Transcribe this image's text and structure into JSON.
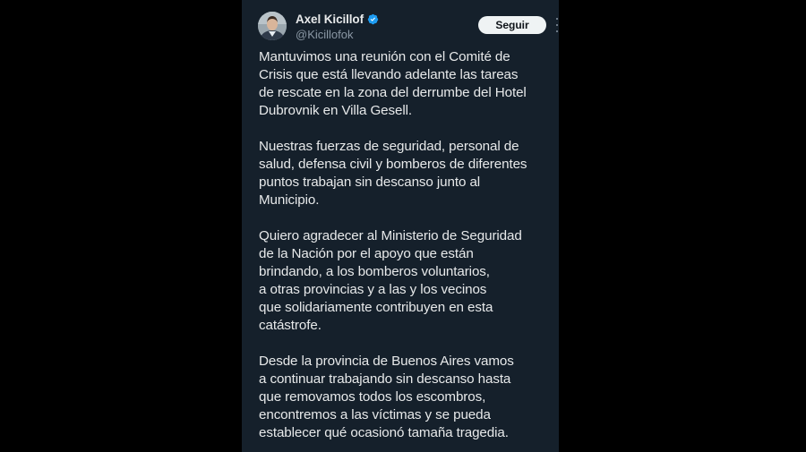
{
  "tweet": {
    "author_name": "Axel Kicillof",
    "author_handle": "@Kicillofok",
    "verified": true,
    "follow_label": "Seguir",
    "paragraphs": [
      [
        "Mantuvimos una reunión con el Comité de",
        "Crisis que está llevando adelante las tareas",
        "de rescate en la zona del derrumbe del Hotel",
        "Dubrovnik en Villa Gesell."
      ],
      [
        "Nuestras fuerzas de seguridad, personal de",
        "salud, defensa civil y bomberos de diferentes",
        "puntos trabajan sin descanso junto al",
        "Municipio."
      ],
      [
        "Quiero agradecer al Ministerio de Seguridad",
        "de la Nación por el apoyo que están",
        "brindando, a los bomberos voluntarios,",
        "a otras provincias y a las y los vecinos",
        "que solidariamente contribuyen en esta",
        "catástrofe."
      ],
      [
        "Desde la provincia de Buenos Aires vamos",
        "a continuar trabajando sin descanso hasta",
        "que removamos todos los escombros,",
        "encontremos a las víctimas y se pueda",
        "establecer qué ocasionó tamaña tragedia."
      ]
    ]
  },
  "icons": {
    "avatar": "avatar-photo",
    "verified": "verified-badge-icon",
    "more": "more-options-icon"
  },
  "colors": {
    "page_background": "#000000",
    "card_background": "#15202b",
    "text_primary": "#e7e9ea",
    "text_secondary": "#8b98a5",
    "verified_blue": "#1d9bf0",
    "follow_button_bg": "#eff3f4",
    "follow_button_text": "#0f1419"
  }
}
